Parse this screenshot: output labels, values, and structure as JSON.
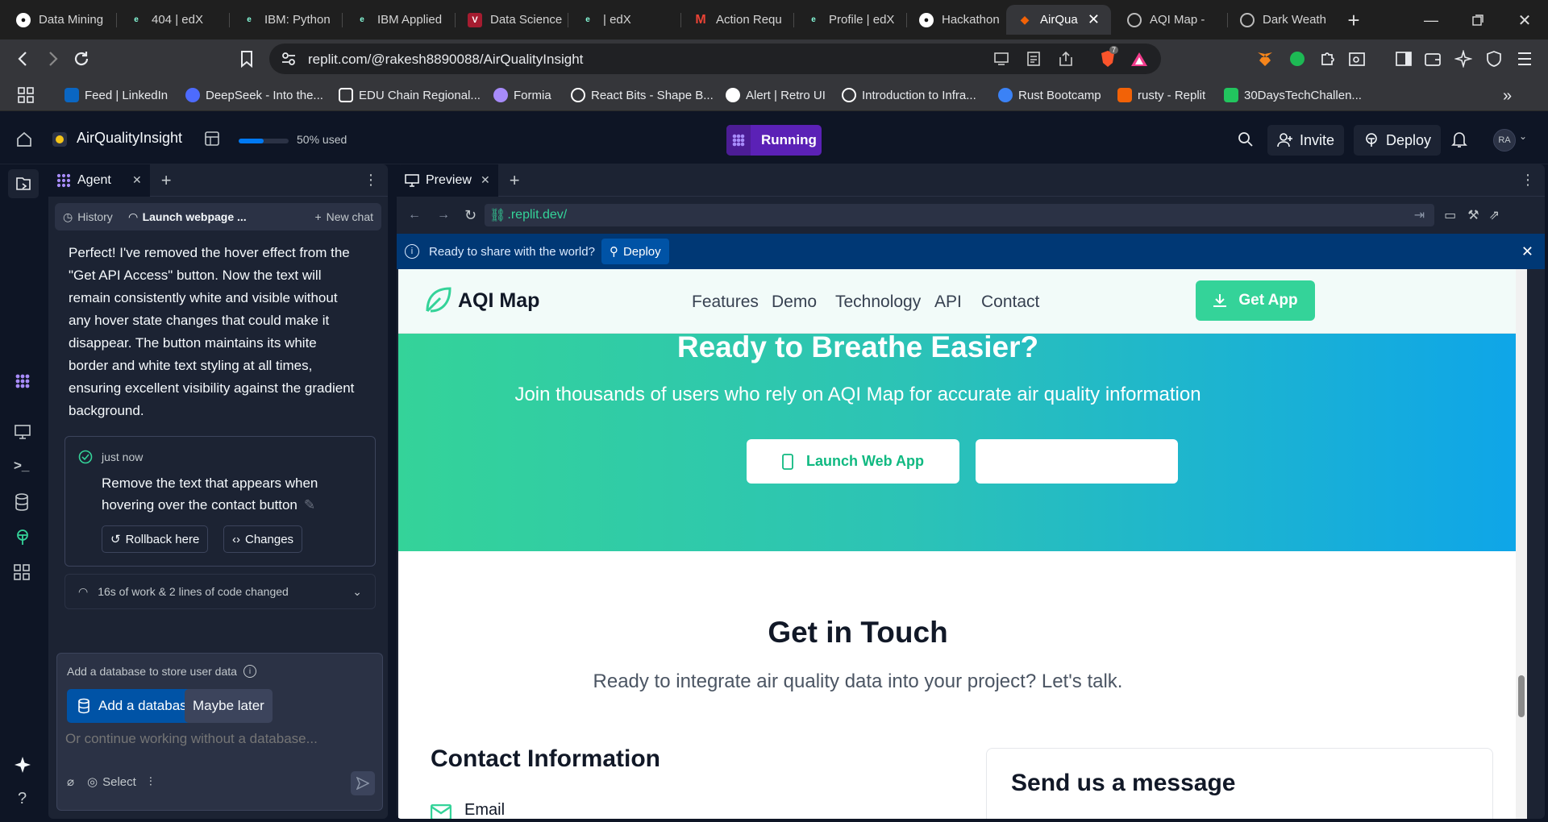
{
  "browser": {
    "tabs": [
      {
        "label": "Data Mining",
        "icon": "github-icon"
      },
      {
        "label": "404 | edX",
        "icon": "edx-icon"
      },
      {
        "label": "IBM: Python",
        "icon": "edx-icon"
      },
      {
        "label": "IBM Applied",
        "icon": "edx-icon"
      },
      {
        "label": "Data Science",
        "icon": "harvard-icon"
      },
      {
        "label": "| edX",
        "icon": "edx-icon"
      },
      {
        "label": "Action Requ",
        "icon": "gmail-icon"
      },
      {
        "label": "Profile | edX",
        "icon": "edx-icon"
      },
      {
        "label": "Hackathon",
        "icon": "github-icon"
      },
      {
        "label": "AirQua",
        "icon": "replit-icon"
      },
      {
        "label": "AQI Map -",
        "icon": "globe-icon"
      },
      {
        "label": "Dark Weath",
        "icon": "globe-icon"
      }
    ],
    "url": "replit.com/@rakesh8890088/AirQualityInsight",
    "brave_badge": "7",
    "bookmarks": [
      {
        "label": "Feed | LinkedIn",
        "color": "#0a66c2"
      },
      {
        "label": "DeepSeek - Into the...",
        "color": "#4d6bfe"
      },
      {
        "label": "EDU Chain Regional...",
        "color": "#ffffff"
      },
      {
        "label": "Formia",
        "color": "#a78bfa"
      },
      {
        "label": "React Bits - Shape B...",
        "color": "#ffffff"
      },
      {
        "label": "Alert | Retro UI",
        "color": "#ffffff"
      },
      {
        "label": "Introduction to Infra...",
        "color": "#ffffff"
      },
      {
        "label": "Rust Bootcamp",
        "color": "#3b82f6"
      },
      {
        "label": "rusty - Replit",
        "color": "#f26207"
      },
      {
        "label": "30DaysTechChallen...",
        "color": "#22c55e"
      }
    ]
  },
  "replit": {
    "project_name": "AirQualityInsight",
    "usage_label": "50% used",
    "usage_fraction": 0.5,
    "status": "Running",
    "invite": "Invite",
    "deploy": "Deploy",
    "avatar": "RA"
  },
  "agent": {
    "tab_label": "Agent",
    "history": "History",
    "current_thread": "Launch webpage ...",
    "new_chat": "New chat",
    "message_lines": [
      "Perfect! I've removed the hover effect from the",
      "\"Get API Access\" button. Now the text will",
      "remain consistently white and visible without",
      "any hover state changes that could make it",
      "disappear. The button maintains its white",
      "border and white text styling at all times,",
      "ensuring excellent visibility against the gradient",
      "background."
    ],
    "checkpoint_time": "just now",
    "checkpoint_lines": [
      "Remove the text that appears when",
      "hovering over the contact button"
    ],
    "rollback": "Rollback here",
    "changes": "Changes",
    "work_summary": "16s of work & 2 lines of code changed",
    "db_prompt": "Add a database to store user data",
    "add_db": "Add a database",
    "maybe_later": "Maybe later",
    "input_placeholder": "Or continue working without a database...",
    "select": "Select"
  },
  "preview": {
    "tab_label": "Preview",
    "url": ".replit.dev/",
    "banner_text": "Ready to share with the world?",
    "banner_deploy": "Deploy"
  },
  "site": {
    "brand": "AQI Map",
    "nav": [
      "Features",
      "Demo",
      "Technology",
      "API",
      "Contact"
    ],
    "get_app": "Get App",
    "hero_title": "Ready to Breathe Easier?",
    "hero_subtitle": "Join thousands of users who rely on AQI Map for accurate air quality information",
    "launch_btn": "Launch Web App",
    "second_btn": "",
    "touch_title": "Get in Touch",
    "touch_subtitle": "Ready to integrate air quality data into your project? Let's talk.",
    "contact_info": "Contact Information",
    "email_label": "Email",
    "message_title": "Send us a message"
  }
}
